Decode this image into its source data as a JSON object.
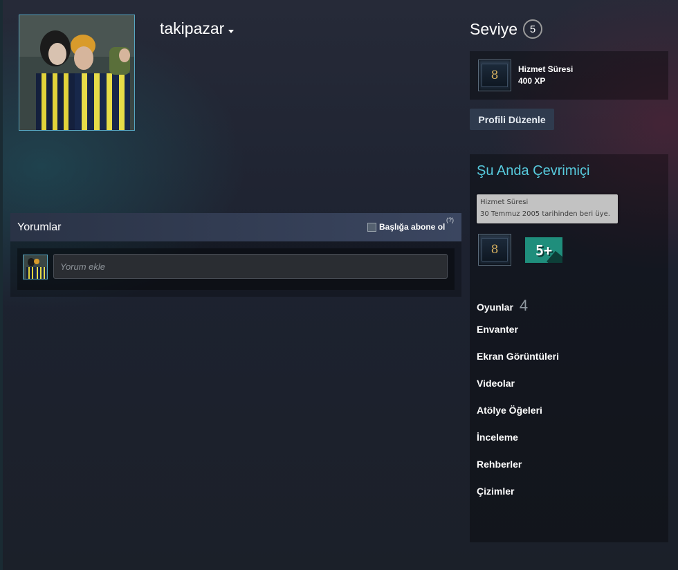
{
  "profile": {
    "username": "takipazar",
    "level_label": "Seviye",
    "level": "5",
    "edit_profile_label": "Profili Düzenle"
  },
  "favorite_badge": {
    "icon": "years-of-service-badge-icon",
    "icon_glyph": "8",
    "name": "Hizmet Süresi",
    "xp": "400 XP"
  },
  "status": {
    "online_text": "Şu Anda Çevrimiçi",
    "color": "#57cbde"
  },
  "tooltip": {
    "title": "Hizmet Süresi",
    "text": "30 Temmuz 2005 tarihinden beri üye."
  },
  "badges": {
    "service_glyph": "8",
    "years_label": "5+"
  },
  "nav": [
    {
      "label": "Oyunlar",
      "count": "4"
    },
    {
      "label": "Envanter"
    },
    {
      "label": "Ekran Görüntüleri"
    },
    {
      "label": "Videolar"
    },
    {
      "label": "Atölye Öğeleri"
    },
    {
      "label": "İnceleme"
    },
    {
      "label": "Rehberler"
    },
    {
      "label": "Çizimler"
    }
  ],
  "comments": {
    "title": "Yorumlar",
    "subscribe_label": "Başlığa abone ol",
    "help_label": "(?)",
    "input_placeholder": "Yorum ekle"
  },
  "colors": {
    "accent": "#57cbde",
    "avatar_border": "#57a6c1",
    "years_badge": "#1f8e7c",
    "button_bg": "#2f3b4e"
  }
}
